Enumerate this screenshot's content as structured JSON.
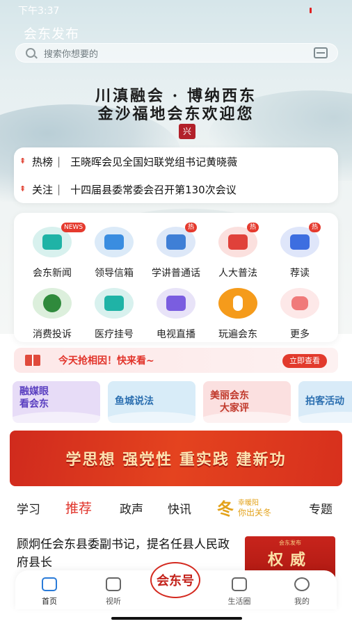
{
  "status": {
    "time": "下午3:37"
  },
  "app": {
    "title": "会东发布"
  },
  "search": {
    "placeholder": "搜索你想要的"
  },
  "hero": {
    "slogan_line1": "川滇融会 · 博纳西东",
    "slogan_line2": "金沙福地会东欢迎您",
    "seal": "兴"
  },
  "headlines": [
    {
      "tag": "热榜",
      "text": "王晓晖会见全国妇联党组书记黄晓薇"
    },
    {
      "tag": "关注",
      "text": "十四届县委常委会召开第130次会议"
    }
  ],
  "grid": [
    {
      "label": "会东新闻",
      "badge": "NEWS",
      "icon": "news-inbox-icon",
      "color": "#1fb3a6"
    },
    {
      "label": "领导信箱",
      "badge": "",
      "icon": "mail-icon",
      "color": "#3a8de0"
    },
    {
      "label": "学讲普通话",
      "badge": "热",
      "icon": "book-icon",
      "color": "#3f7fd6"
    },
    {
      "label": "人大普法",
      "badge": "热",
      "icon": "gavel-icon",
      "color": "#e0413a"
    },
    {
      "label": "荐读",
      "badge": "热",
      "icon": "headphones-icon",
      "color": "#3d6ee0"
    },
    {
      "label": "消费投诉",
      "badge": "",
      "icon": "complaint-icon",
      "color": "#2f8a3c"
    },
    {
      "label": "医疗挂号",
      "badge": "",
      "icon": "medical-icon",
      "color": "#1fb3a6"
    },
    {
      "label": "电视直播",
      "badge": "",
      "icon": "tv-live-icon",
      "color": "#7a5de0"
    },
    {
      "label": "玩遍会东",
      "badge": "",
      "icon": "person-icon",
      "color": "#f59b1b"
    },
    {
      "label": "更多",
      "badge": "",
      "icon": "more-icon",
      "color": "#f07a7a"
    }
  ],
  "promo": {
    "text": "今天抢相因！快来看~",
    "button": "立即查看"
  },
  "categories": [
    {
      "line1": "融媒眼",
      "line2": "看会东",
      "bg": "#e7dcf7",
      "color": "#5a3fc0"
    },
    {
      "line1": "鱼城说法",
      "line2": "",
      "bg": "#d8ecf8",
      "color": "#2b6fb0"
    },
    {
      "line1": "美丽会东",
      "line2": "大家评",
      "bg": "#fbe0e0",
      "color": "#c0392b"
    },
    {
      "line1": "拍客活动",
      "line2": "",
      "bg": "#d9ebf8",
      "color": "#2b6fb0"
    }
  ],
  "banner": {
    "text": "学思想 强党性 重实践 建新功"
  },
  "tabs": [
    "学习",
    "推荐",
    "政声",
    "快讯",
    "专题"
  ],
  "tab_special": {
    "big": "冬",
    "small1": "幸暖阳",
    "small2": "你出关冬"
  },
  "article": {
    "title": "顾炯任会东县委副书记，提名任县人民政府县长",
    "thumb_small": "会东发布",
    "thumb_big": "权威"
  },
  "bottom_nav": {
    "items": [
      "首页",
      "视听",
      "生活圈",
      "我的"
    ],
    "center": "会东号"
  }
}
